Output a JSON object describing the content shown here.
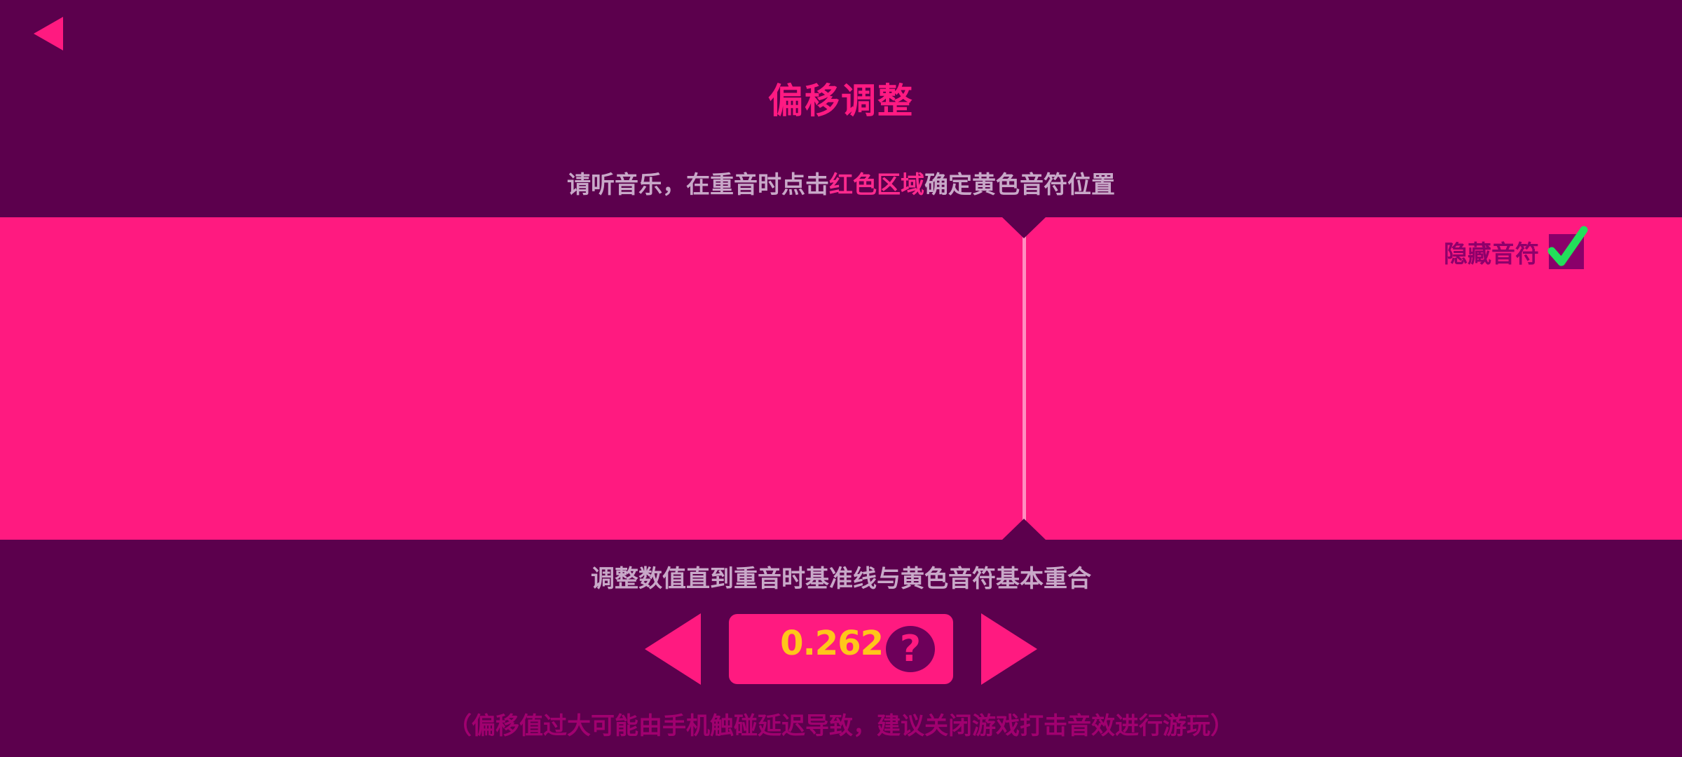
{
  "header": {
    "back_icon": "back-triangle-icon",
    "title": "偏移调整"
  },
  "instruction": {
    "before": "请听音乐，在重音时点击",
    "highlight": "红色区域",
    "after": "确定黄色音符位置"
  },
  "hide_notes": {
    "label": "隐藏音符",
    "checked": true,
    "check_icon": "check-icon"
  },
  "hint": "调整数值直到重音时基准线与黄色音符基本重合",
  "offset": {
    "value": "0.262",
    "decrease_icon": "left-arrow-icon",
    "increase_icon": "right-arrow-icon",
    "help_glyph": "?"
  },
  "footnote": "（偏移值过大可能由手机触碰延迟导致，建议关闭游戏打击音效进行游玩）",
  "colors": {
    "background": "#5c004d",
    "accent": "#ff1a80",
    "value": "#ffc61a",
    "check": "#22e05a"
  }
}
